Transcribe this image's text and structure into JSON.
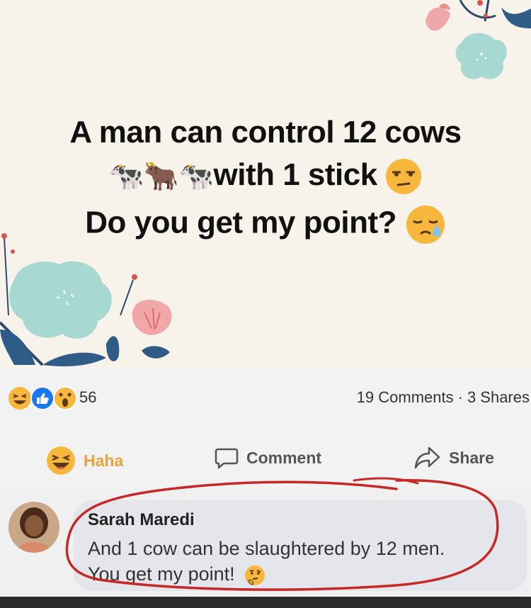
{
  "post": {
    "line1": "A man can control 12 cows",
    "line2_text": "with 1 stick",
    "line3": "Do you get my point?",
    "cows": [
      "🐄",
      "🐂",
      "🐄"
    ]
  },
  "reactions": {
    "count": "56",
    "comments": "19 Comments",
    "separator": "·",
    "shares": "3 Shares"
  },
  "actions": {
    "haha_label": "Haha",
    "comment_label": "Comment",
    "share_label": "Share"
  },
  "comment": {
    "author": "Sarah Maredi",
    "line1": "And 1 cow can be slaughtered by 12 men.",
    "line2": "You get my point!"
  },
  "colors": {
    "haha": "#e8a33d",
    "like": "#1877f2",
    "annotation": "#c62828"
  },
  "icons": [
    "haha-emoji-icon",
    "like-icon",
    "wow-icon",
    "comment-icon",
    "share-icon",
    "unamused-emoji-icon",
    "sleepy-emoji-icon",
    "thinking-emoji-icon"
  ]
}
